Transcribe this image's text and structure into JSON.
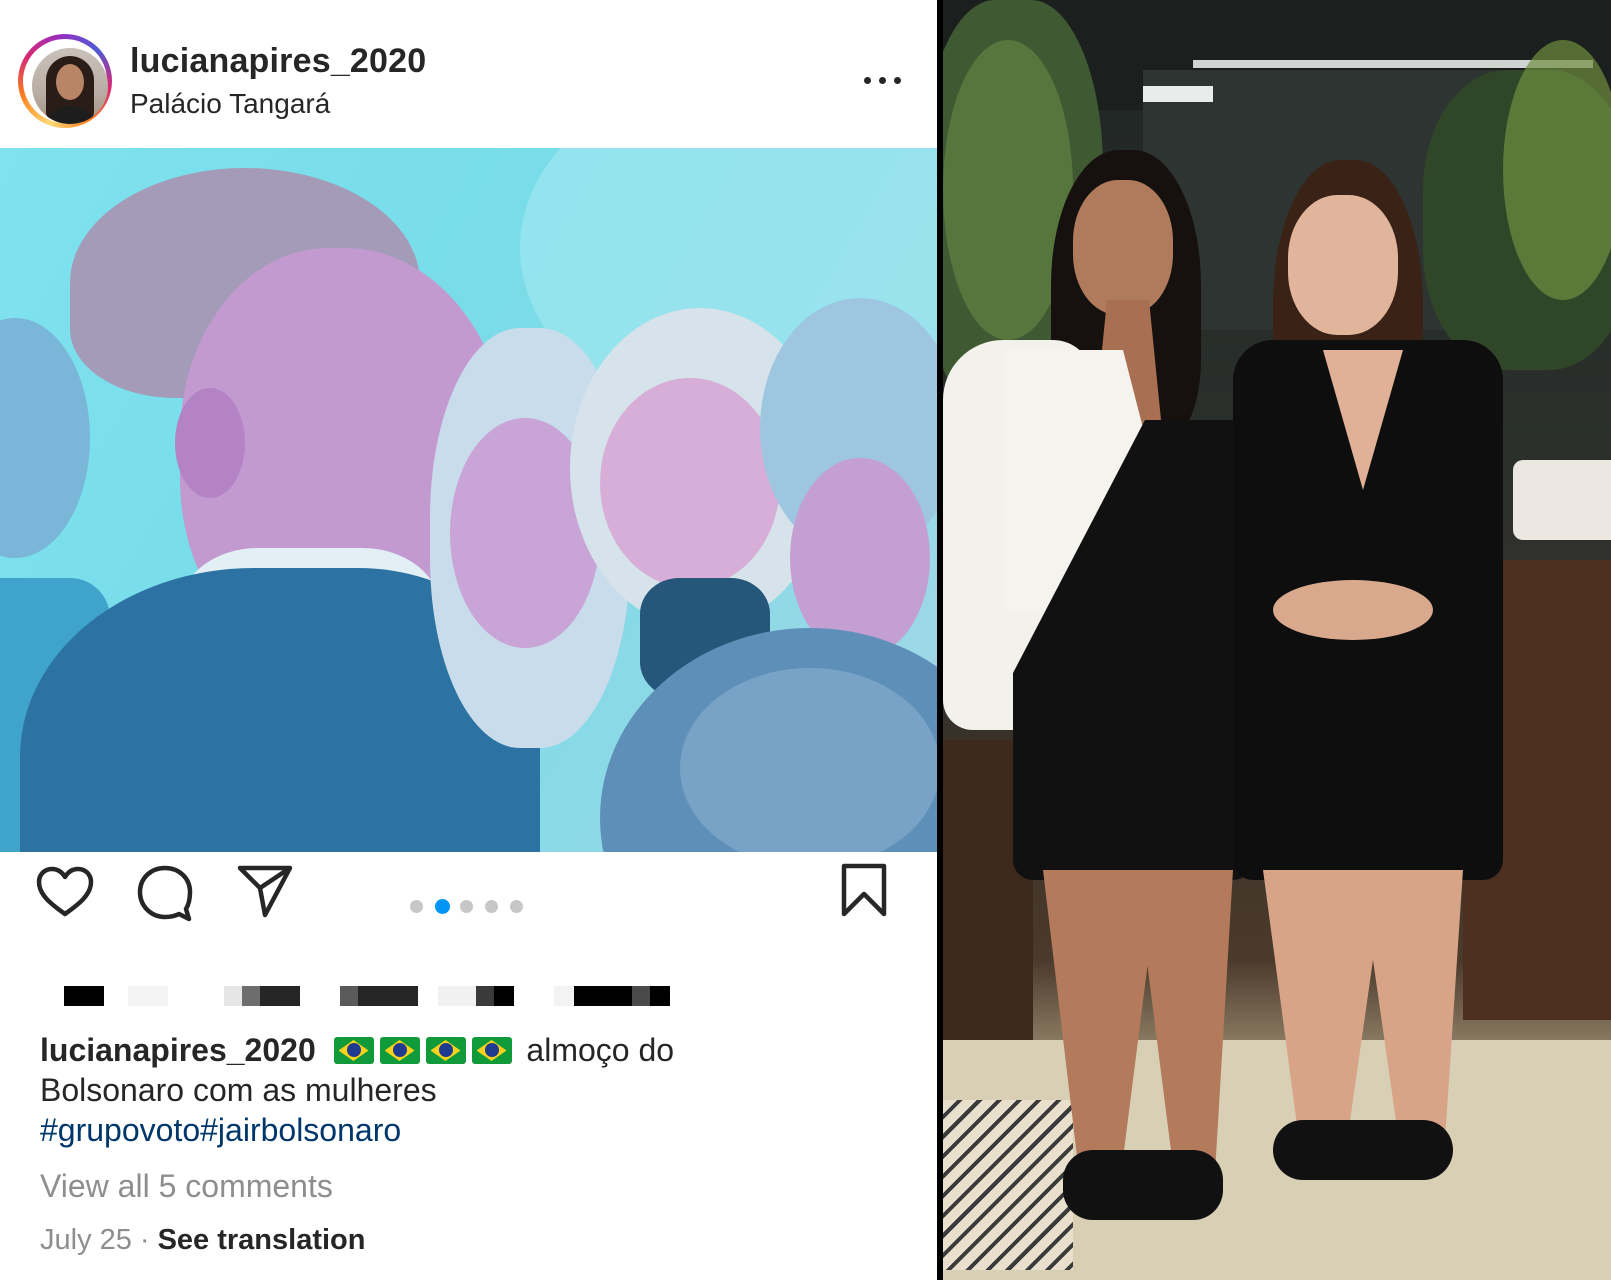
{
  "post": {
    "username": "lucianapires_2020",
    "location": "Palácio Tangará",
    "more_label": "•••",
    "carousel": {
      "count": 5,
      "active_index": 1
    },
    "caption": {
      "username": "lucianapires_2020",
      "flag_count": 4,
      "text_line1": "almoço do",
      "text_line2": "Bolsonaro com as mulheres",
      "hashtags": "#grupovoto#jairbolsonaro"
    },
    "view_comments": "View all 5 comments",
    "date": "July 25",
    "separator": "·",
    "see_translation": "See translation"
  },
  "icons": [
    "heart-icon",
    "comment-icon",
    "share-icon",
    "bookmark-icon",
    "more-icon"
  ],
  "colors": {
    "link": "#00376b",
    "active_dot": "#0095f6",
    "muted_text": "#8e8e8e",
    "text": "#262626"
  }
}
